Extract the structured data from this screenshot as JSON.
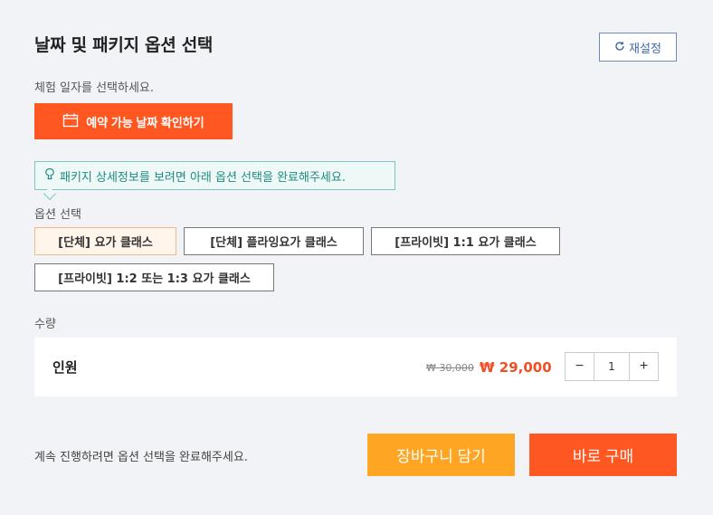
{
  "header": {
    "title": "날짜 및 패키지 옵션 선택",
    "reset_label": "재설정"
  },
  "date": {
    "instruction": "체험 일자를 선택하세요.",
    "button_label": "예약 가능 날짜 확인하기"
  },
  "notice": {
    "text": "패키지 상세정보를 보려면 아래 옵션 선택을 완료해주세요."
  },
  "options": {
    "label": "옵션 선택",
    "items": [
      {
        "label": "[단체] 요가 클래스",
        "selected": true
      },
      {
        "label": "[단체] 플라잉요가 클래스",
        "selected": false
      },
      {
        "label": "[프라이빗] 1:1 요가 클래스",
        "selected": false
      },
      {
        "label": "[프라이빗] 1:2 또는 1:3 요가 클래스",
        "selected": false
      }
    ]
  },
  "quantity": {
    "label": "수량",
    "row": {
      "name": "인원",
      "original_price": "₩ 30,000",
      "sale_price": "₩ 29,000",
      "minus": "−",
      "value": "1",
      "plus": "+"
    }
  },
  "footer": {
    "message": "계속 진행하려면 옵션 선택을 완료해주세요.",
    "cart_label": "장바구니 담기",
    "buy_label": "바로 구매"
  },
  "colors": {
    "primary": "#ff5722",
    "cart": "#ffa524",
    "notice": "#1e8b80",
    "link": "#3f6aa8"
  },
  "icons": {
    "reset": "refresh-icon",
    "date": "calendar-icon",
    "notice": "balloon-icon"
  }
}
